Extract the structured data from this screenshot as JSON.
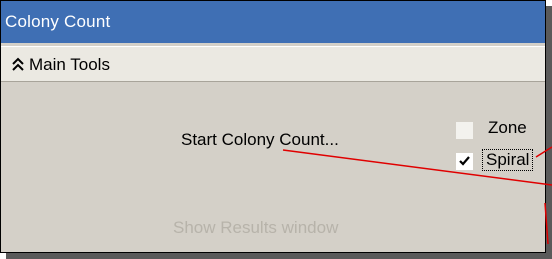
{
  "window": {
    "title": "Colony Count"
  },
  "section": {
    "label": "Main Tools",
    "icon": "chevron-up-double-icon"
  },
  "actions": {
    "start_colony_count": "Start Colony Count...",
    "show_results_window": "Show Results window"
  },
  "options": {
    "zone": {
      "label": "Zone",
      "checked": false
    },
    "spiral": {
      "label": "Spiral",
      "checked": true
    }
  },
  "colors": {
    "titlebar": "#3f6fb4",
    "panel": "#d4d0c8",
    "annotation_line": "#e00000",
    "disabled_text": "#b7b3aa"
  }
}
